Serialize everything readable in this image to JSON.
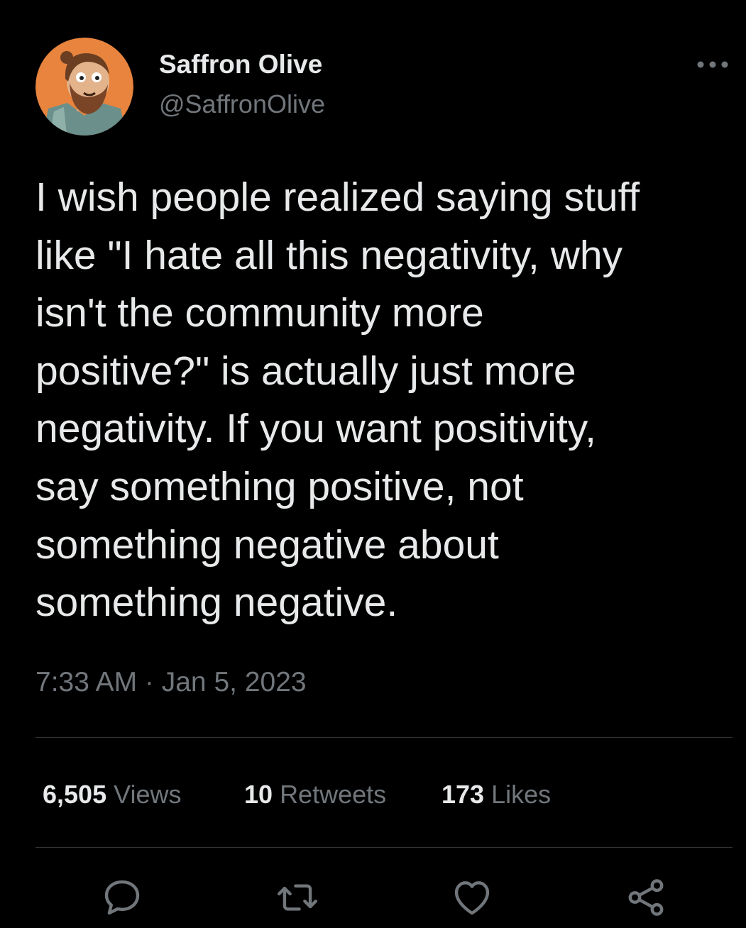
{
  "author": {
    "display_name": "Saffron Olive",
    "handle": "@SaffronOlive"
  },
  "tweet": {
    "lines": [
      "I wish people realized saying stuff",
      "like \"I hate all this negativity, why",
      "isn't the community more",
      "positive?\" is actually just more",
      "negativity. If you want positivity,",
      "say something positive, not",
      "something negative about",
      "something negative."
    ],
    "timestamp": "7:33 AM · Jan 5, 2023"
  },
  "stats": {
    "views_count": "6,505",
    "views_label": "Views",
    "retweets_count": "10",
    "retweets_label": "Retweets",
    "likes_count": "173",
    "likes_label": "Likes"
  },
  "icons": {
    "more": "more-horizontal-icon",
    "reply": "reply-icon",
    "retweet": "retweet-icon",
    "like": "heart-icon",
    "share": "share-icon"
  },
  "colors": {
    "background": "#000000",
    "primary_text": "#e7e9ea",
    "secondary_text": "#71767b",
    "divider": "#2f3336",
    "avatar_background": "#e8843d"
  }
}
